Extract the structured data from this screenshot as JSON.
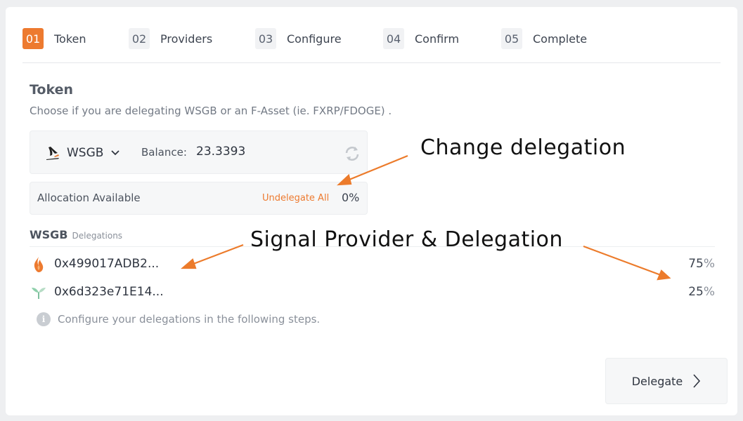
{
  "stepper": {
    "steps": [
      {
        "num": "01",
        "label": "Token",
        "active": true
      },
      {
        "num": "02",
        "label": "Providers",
        "active": false
      },
      {
        "num": "03",
        "label": "Configure",
        "active": false
      },
      {
        "num": "04",
        "label": "Confirm",
        "active": false
      },
      {
        "num": "05",
        "label": "Complete",
        "active": false
      }
    ]
  },
  "token_section": {
    "title": "Token",
    "description": "Choose if you are delegating WSGB or an F-Asset (ie. FXRP/FDOGE) ."
  },
  "token_box": {
    "token_name": "WSGB",
    "balance_label": "Balance:",
    "balance_value": "23.3393",
    "token_icon": "songbird-bird-icon",
    "refresh_icon": "refresh-icon"
  },
  "allocation": {
    "label": "Allocation Available",
    "undelegate_label": "Undelegate All",
    "percent": "0%"
  },
  "delegations": {
    "token": "WSGB",
    "subtitle": "Delegations",
    "rows": [
      {
        "address": "0x499017ADB2...",
        "percent": "75",
        "icon": "flame-icon"
      },
      {
        "address": "0x6d323e71E14...",
        "percent": "25",
        "icon": "sprout-icon"
      }
    ],
    "percent_symbol": "%"
  },
  "info": {
    "text": "Configure your delegations in the following steps."
  },
  "delegate_button": {
    "label": "Delegate"
  },
  "annotations": {
    "change_delegation": "Change delegation",
    "signal_provider": "Signal Provider & Delegation"
  },
  "colors": {
    "accent": "#ed7a2f",
    "background": "#eeeff1",
    "card": "#ffffff"
  }
}
